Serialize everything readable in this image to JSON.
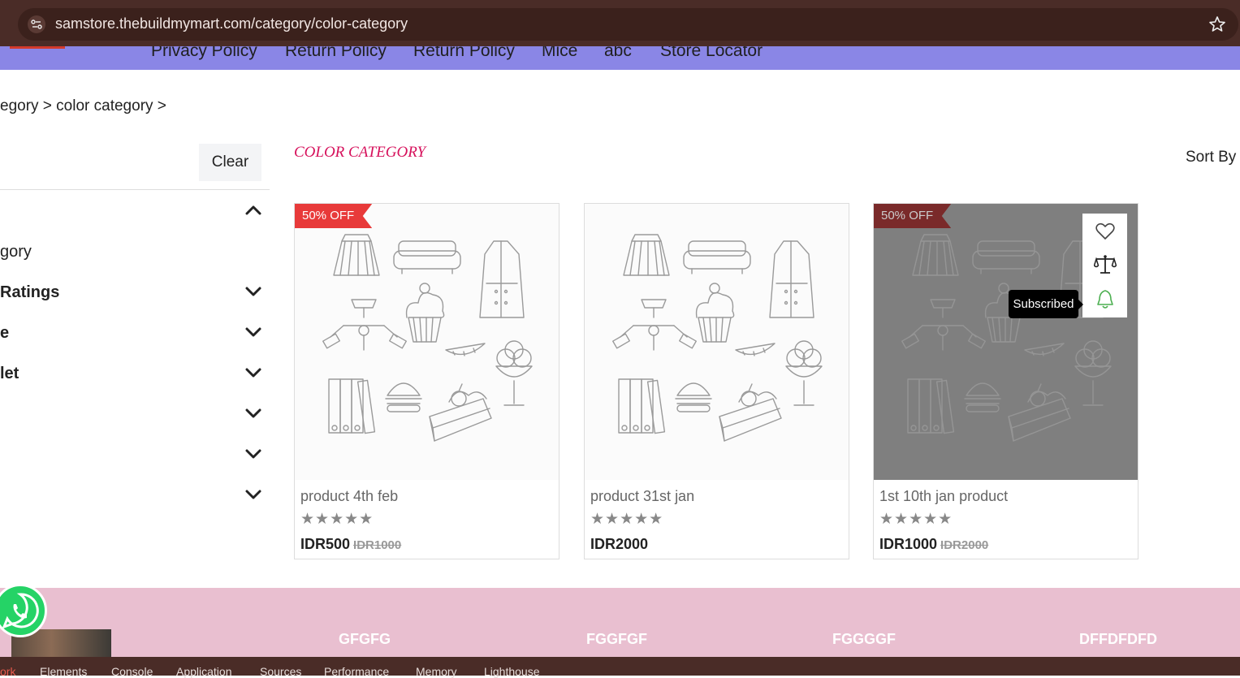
{
  "browser": {
    "url": "samstore.thebuildmymart.com/category/color-category"
  },
  "nav": {
    "items": [
      "Privacy Policy",
      "Return Policy",
      "Return Policy",
      "Mice",
      "abc",
      "Store Locator"
    ]
  },
  "breadcrumb": "egory > color category >",
  "sidebar": {
    "clear_label": "Clear",
    "filters": [
      "gory",
      "Ratings",
      "e",
      "let"
    ]
  },
  "main": {
    "title": "COLOR CATEGORY",
    "sort_label": "Sort By"
  },
  "products": [
    {
      "badge": "50% OFF",
      "name": "product 4th feb",
      "stars": "★★★★★",
      "price": "IDR500",
      "old_price": "IDR1000"
    },
    {
      "badge": "",
      "name": "product 31st jan",
      "stars": "★★★★★",
      "price": "IDR2000",
      "old_price": ""
    },
    {
      "badge": "50% OFF",
      "name": "1st 10th jan product",
      "stars": "★★★★★",
      "price": "IDR1000",
      "old_price": "IDR2000"
    }
  ],
  "hover_actions": {
    "tooltip": "Subscribed",
    "icons": [
      "heart-icon",
      "compare-scale-icon",
      "bell-icon"
    ]
  },
  "footer": {
    "headings": [
      "GFGFG",
      "FGGFGF",
      "FGGGGF",
      "DFFDFDFD"
    ]
  },
  "devtools": {
    "tabs": [
      "ork",
      "Elements",
      "Console",
      "Application",
      "Sources",
      "Performance",
      "Memory",
      "Lighthouse"
    ]
  },
  "colors": {
    "nav_bg": "#8a86e6",
    "title": "#d6105b",
    "badge": "#e83a3a",
    "footer_bg": "#e9bfd0",
    "bell_active": "#4caf50"
  }
}
